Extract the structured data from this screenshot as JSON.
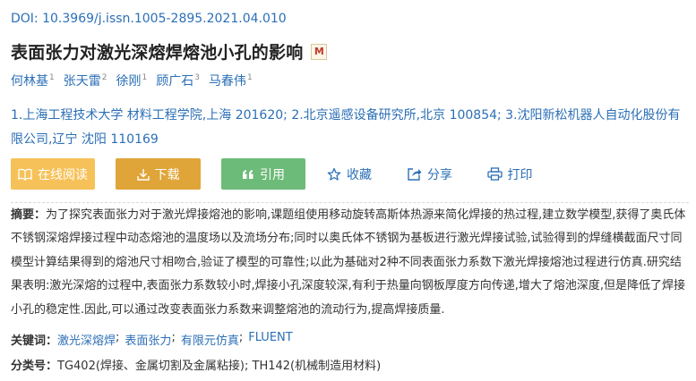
{
  "doi": {
    "label": "DOI:",
    "value": "10.3969/j.issn.1005-2895.2021.04.010"
  },
  "title": "表面张力对激光深熔焊熔池小孔的影响",
  "badge": "M",
  "authors": [
    {
      "name": "何林基",
      "sup": "1"
    },
    {
      "name": "张天雷",
      "sup": "2"
    },
    {
      "name": "徐刚",
      "sup": "1"
    },
    {
      "name": "顾广石",
      "sup": "3"
    },
    {
      "name": "马春伟",
      "sup": "1"
    }
  ],
  "affiliations": "1.上海工程技术大学 材料工程学院,上海 201620;  2.北京遥感设备研究所,北京 100854;  3.沈阳新松机器人自动化股份有限公司,辽宁 沈阳 110169",
  "actions": {
    "read": "在线阅读",
    "download": "下载",
    "cite": "引用",
    "favorite": "收藏",
    "share": "分享",
    "print": "打印"
  },
  "abstract": {
    "label": "摘要：",
    "text": "为了探究表面张力对于激光焊接熔池的影响,课题组使用移动旋转高斯体热源来简化焊接的热过程,建立数学模型,获得了奥氏体不锈钢深熔焊接过程中动态熔池的温度场以及流场分布;同时以奥氏体不锈钢为基板进行激光焊接试验,试验得到的焊缝横截面尺寸同模型计算结果得到的熔池尺寸相吻合,验证了模型的可靠性;以此为基础对2种不同表面张力系数下激光焊接熔池过程进行仿真.研究结果表明:激光深熔的过程中,表面张力系数较小时,焊接小孔深度较深,有利于热量向钢板厚度方向传递,增大了熔池深度,但是降低了焊接小孔的稳定性.因此,可以通过改变表面张力系数来调整熔池的流动行为,提高焊接质量."
  },
  "keywords": {
    "label": "关键词：",
    "items": [
      "激光深熔焊",
      "表面张力",
      "有限元仿真",
      "FLUENT"
    ]
  },
  "classification": {
    "label": "分类号：",
    "value": "TG402(焊接、金属切割及金属粘接);  TH142(机械制造用材料)"
  },
  "colors": {
    "link": "#2b6fb6",
    "read_button": "#f6c158",
    "download_button": "#e0a538",
    "cite_button": "#6dbb78"
  },
  "icons": {
    "read": "book-icon",
    "download": "download-icon",
    "cite": "quote-icon",
    "favorite": "star-icon",
    "share": "share-icon",
    "print": "printer-icon"
  }
}
